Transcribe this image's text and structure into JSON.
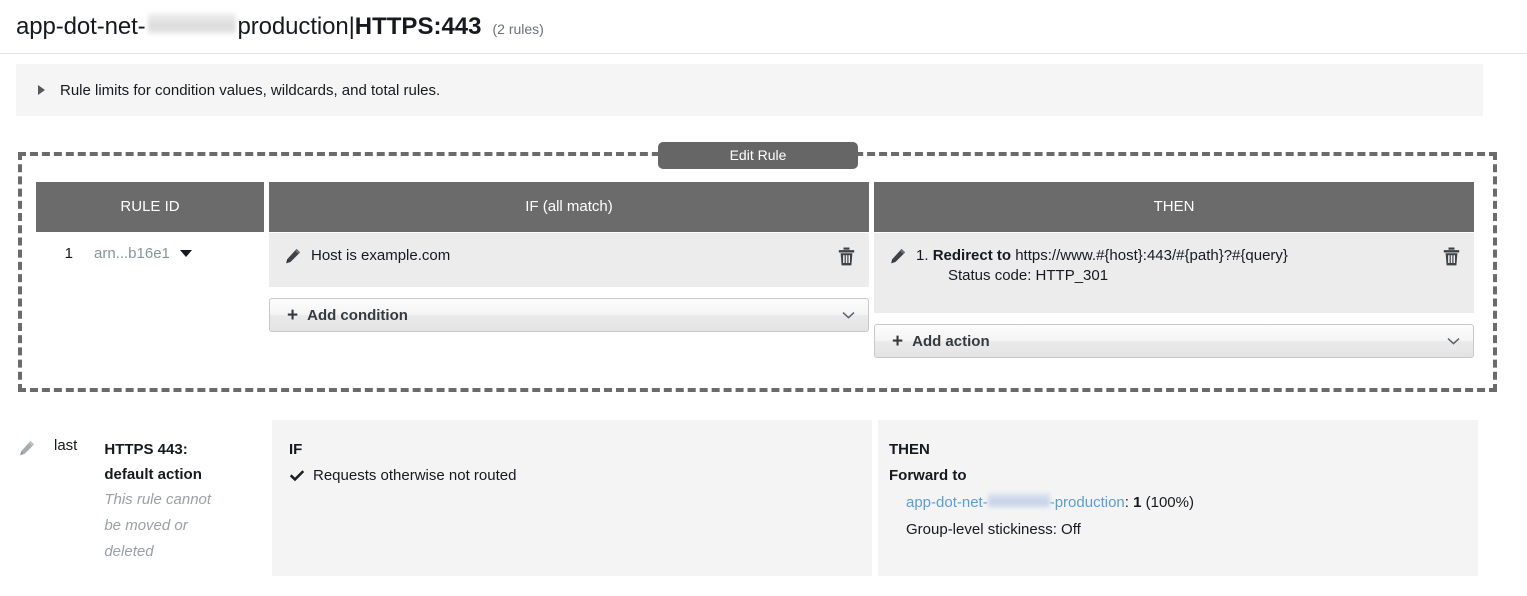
{
  "header": {
    "name_prefix": "app-dot-net-",
    "name_redacted": true,
    "name_suffix": " production",
    "separator": " | ",
    "protocol_port": "HTTPS:443",
    "rules_count": "(2 rules)"
  },
  "info_panel": {
    "icon": "disclosure-triangle-icon",
    "text": "Rule limits for condition values, wildcards, and total rules."
  },
  "edit_rule_button": {
    "label": "Edit Rule"
  },
  "rule_table": {
    "headers": {
      "rule_id": "RULE ID",
      "if": "IF (all match)",
      "then": "THEN"
    },
    "rows": [
      {
        "number": "1",
        "arn": "arn...b16e1",
        "arn_caret": "chevron-down-icon",
        "conditions": [
          {
            "icon": "pencil-icon",
            "label": "Host is",
            "value": "example.com",
            "delete_icon": "trash-icon"
          }
        ],
        "actions": [
          {
            "icon": "pencil-icon",
            "index": "1.",
            "label": "Redirect to",
            "value": "https://www.#{host}:443/#{path}?#{query}",
            "detail": "Status code: HTTP_301",
            "delete_icon": "trash-icon"
          }
        ]
      }
    ],
    "add_condition": {
      "plus": "+",
      "label": "Add condition",
      "chevron": "chevron-down-icon"
    },
    "add_action": {
      "plus": "+",
      "label": "Add action",
      "chevron": "chevron-down-icon"
    }
  },
  "default_rule": {
    "pencil_icon": "pencil-icon",
    "position": "last",
    "title_line1": "HTTPS 443:",
    "title_line2": "default action",
    "note_line1": "This rule cannot",
    "note_line2": "be moved or",
    "note_line3": "deleted",
    "if": {
      "heading": "IF",
      "check_icon": "check-icon",
      "text": "Requests otherwise not routed"
    },
    "then": {
      "heading": "THEN",
      "action": "Forward to",
      "target_prefix": "app-dot-net-",
      "target_suffix": "-production",
      "target_colon": ":",
      "target_weight": "1",
      "target_percent": "(100%)",
      "stickiness": "Group-level stickiness: Off"
    }
  },
  "colors": {
    "header_gray": "#6b6b6b",
    "cell_gray": "#ececec",
    "panel_gray": "#f5f5f5",
    "link_blue": "#5b9dd9",
    "muted": "#879596"
  }
}
